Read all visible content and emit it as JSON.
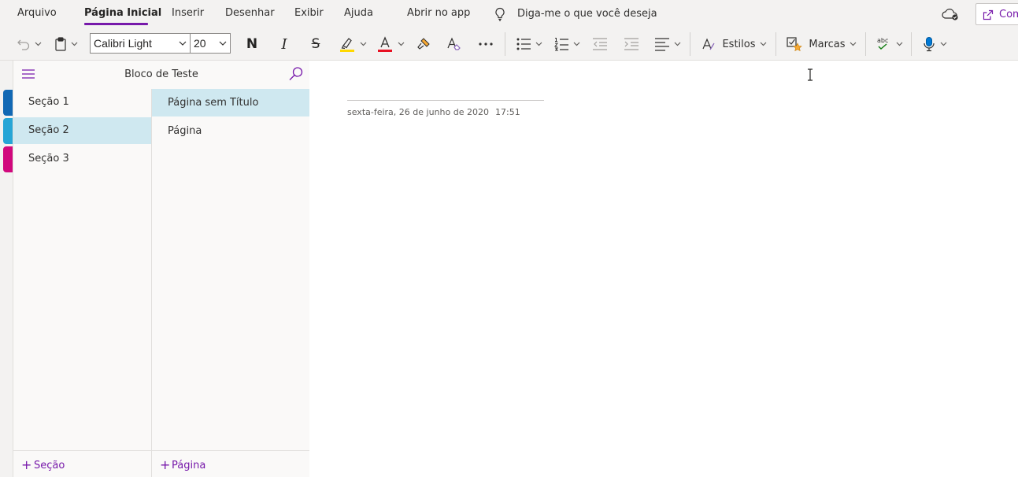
{
  "menu": {
    "items": [
      "Arquivo",
      "Página Inicial",
      "Inserir",
      "Desenhar",
      "Exibir",
      "Ajuda",
      "Abrir no app"
    ],
    "active": "Página Inicial",
    "tell_me": "Diga-me o que você deseja fazer",
    "share_label": "Com"
  },
  "ribbon": {
    "font_name": "Calibri Light",
    "font_size": "20",
    "bold_glyph": "N",
    "italic_glyph": "I",
    "underline_glyph": "S",
    "styles_label": "Estilos",
    "tags_label": "Marcas",
    "spelling_glyph": "abc",
    "highlight_color": "#ffd800",
    "font_color": "#e81123"
  },
  "notebook": {
    "title": "Bloco de Teste"
  },
  "sections": {
    "items": [
      "Seção 1",
      "Seção 2",
      "Seção 3"
    ],
    "selected": "Seção 2",
    "tab_colors": [
      "#1168b4",
      "#26a5d6",
      "#d1087d"
    ],
    "add_label": "Seção"
  },
  "pages": {
    "items": [
      "Página sem Título",
      "Página"
    ],
    "selected": "Página sem Título",
    "add_label": "Página"
  },
  "canvas": {
    "date": "sexta-feira, 26 de junho de 2020",
    "time": "17:51"
  },
  "colors": {
    "accent": "#7719aa",
    "selection": "#cfe8f0"
  }
}
